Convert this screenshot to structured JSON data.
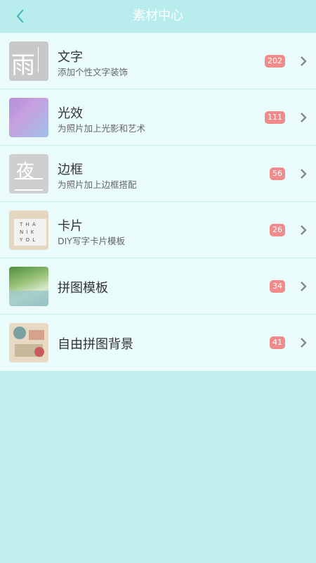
{
  "header": {
    "title": "素材中心",
    "back_icon": "chevron-left-icon"
  },
  "colors": {
    "header_bg": "#b9eded",
    "list_bg": "#e9fbfb",
    "badge": "#f08b8b",
    "page_bg": "#c2f0f0"
  },
  "items": [
    {
      "title": "文字",
      "subtitle": "添加个性文字装饰",
      "count": "202",
      "thumb_text": "雨"
    },
    {
      "title": "光效",
      "subtitle": "为照片加上光影和艺术",
      "count": "111"
    },
    {
      "title": "边框",
      "subtitle": "为照片加上边框搭配",
      "count": "56",
      "thumb_text": "夜"
    },
    {
      "title": "卡片",
      "subtitle": "DIY写字卡片模板",
      "count": "26",
      "thumb_lines": [
        "T H A",
        "N I K",
        "Y O L"
      ]
    },
    {
      "title": "拼图模板",
      "subtitle": "",
      "count": "34"
    },
    {
      "title": "自由拼图背景",
      "subtitle": "",
      "count": "41"
    }
  ]
}
